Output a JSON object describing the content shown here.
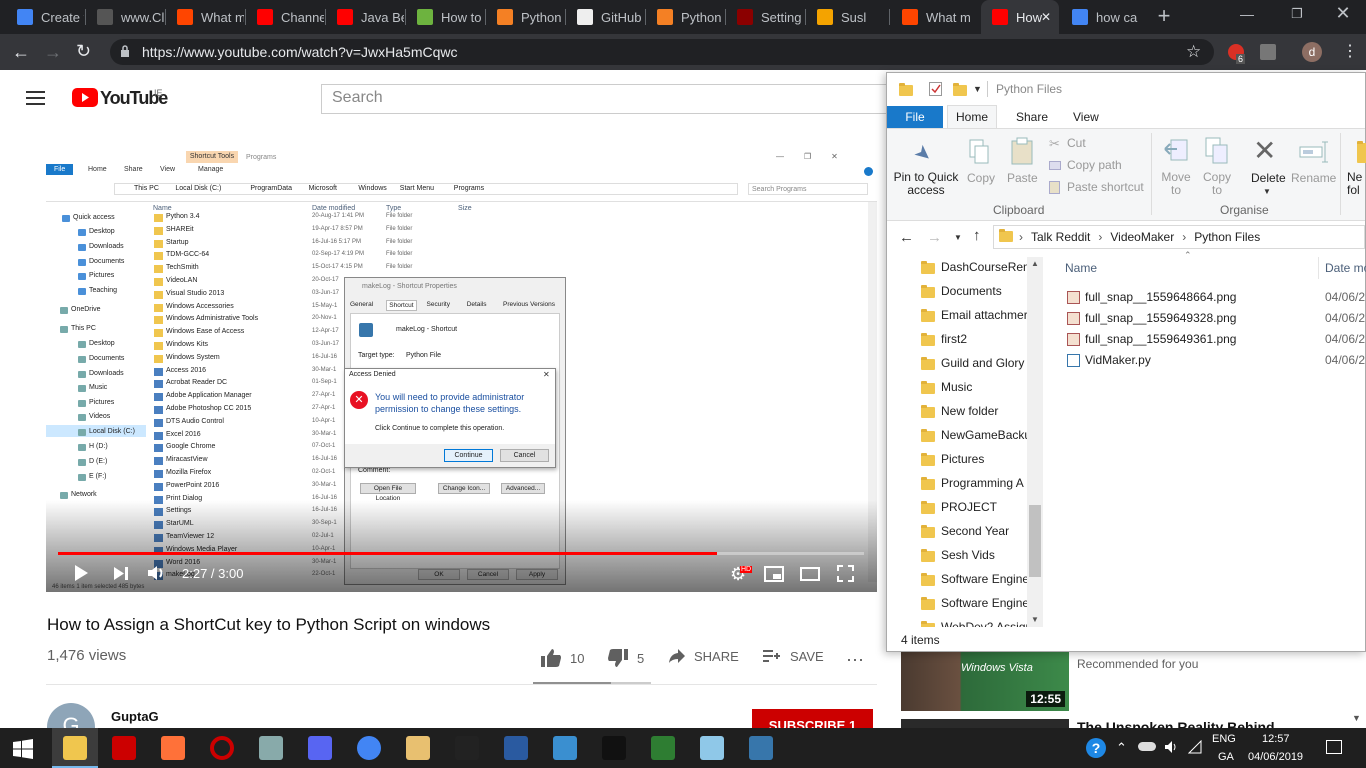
{
  "browser": {
    "tabs": [
      {
        "label": "Create y",
        "color": "#4285f4"
      },
      {
        "label": "www.Cl",
        "color": "#555"
      },
      {
        "label": "What m",
        "color": "#ff4500"
      },
      {
        "label": "Channe",
        "color": "#ff0000"
      },
      {
        "label": "Java Be",
        "color": "#ff0000"
      },
      {
        "label": "How to",
        "color": "#6db33f"
      },
      {
        "label": "Python",
        "color": "#f48024"
      },
      {
        "label": "GitHub",
        "color": "#eee"
      },
      {
        "label": "Python",
        "color": "#f48024"
      },
      {
        "label": "Setting",
        "color": "#8b0000"
      },
      {
        "label": "Susl",
        "color": "#f4a300"
      },
      {
        "label": "What m",
        "color": "#ff4500"
      },
      {
        "label": "How",
        "color": "#ff0000"
      },
      {
        "label": "how ca",
        "color": "#4285f4"
      }
    ],
    "url": "https://www.youtube.com/watch?v=JwxHa5mCqwc",
    "profile_initial": "d",
    "ext_badge": "6"
  },
  "youtube": {
    "logo_text": "YouTube",
    "region": "IE",
    "search_placeholder": "Search",
    "video_title": "How to Assign a ShortCut key to Python Script on windows",
    "views": "1,476 views",
    "likes": "10",
    "dislikes": "5",
    "share": "SHARE",
    "save": "SAVE",
    "time": "2:27 / 3:00",
    "progress": 0.817,
    "hd_badge": "HD",
    "channel_initial": "G",
    "channel_name": "GuptaG",
    "subscribe": "SUBSCRIBE 1",
    "rec1": {
      "label": "Recommended for you",
      "duration": "12:55",
      "thumb_text": "Windows Vista"
    },
    "rec2": {
      "title": "The Unspoken Reality Behind"
    }
  },
  "video_frame": {
    "ribbon_tabs": [
      "File",
      "Home",
      "Share",
      "View",
      "Manage"
    ],
    "shortcut_tools": "Shortcut Tools",
    "programs": "Programs",
    "path": [
      "This PC",
      "Local Disk (C:)",
      "ProgramData",
      "Microsoft",
      "Windows",
      "Start Menu",
      "Programs"
    ],
    "search": "Search Programs",
    "nav": [
      "Quick access",
      "Desktop",
      "Downloads",
      "Documents",
      "Pictures",
      "Teaching",
      "OneDrive",
      "This PC",
      "Desktop",
      "Documents",
      "Downloads",
      "Music",
      "Pictures",
      "Videos",
      "Local Disk (C:)",
      "H (D:)",
      "D (E:)",
      "E (F:)",
      "Network"
    ],
    "cols": [
      "Name",
      "Date modified",
      "Type",
      "Size"
    ],
    "files": [
      {
        "name": "Python 3.4",
        "date": "20-Aug-17 1:41 PM",
        "type": "File folder"
      },
      {
        "name": "SHAREit",
        "date": "19-Apr-17 8:57 PM",
        "type": "File folder"
      },
      {
        "name": "Startup",
        "date": "16-Jul-16 5:17 PM",
        "type": "File folder"
      },
      {
        "name": "TDM-GCC-64",
        "date": "02-Sep-17 4:19 PM",
        "type": "File folder"
      },
      {
        "name": "TechSmith",
        "date": "15-Oct-17 4:15 PM",
        "type": "File folder"
      },
      {
        "name": "VideoLAN",
        "date": "20-Oct-17",
        "type": ""
      },
      {
        "name": "Visual Studio 2013",
        "date": "03-Jun-17",
        "type": ""
      },
      {
        "name": "Windows Accessories",
        "date": "15-May-1",
        "type": ""
      },
      {
        "name": "Windows Administrative Tools",
        "date": "20-Nov-1",
        "type": ""
      },
      {
        "name": "Windows Ease of Access",
        "date": "12-Apr-17",
        "type": ""
      },
      {
        "name": "Windows Kits",
        "date": "03-Jun-17",
        "type": ""
      },
      {
        "name": "Windows System",
        "date": "16-Jul-16",
        "type": ""
      },
      {
        "name": "Access 2016",
        "date": "30-Mar-1",
        "type": ""
      },
      {
        "name": "Acrobat Reader DC",
        "date": "01-Sep-1",
        "type": ""
      },
      {
        "name": "Adobe Application Manager",
        "date": "27-Apr-1",
        "type": ""
      },
      {
        "name": "Adobe Photoshop CC 2015",
        "date": "27-Apr-1",
        "type": ""
      },
      {
        "name": "DTS Audio Control",
        "date": "10-Apr-1",
        "type": ""
      },
      {
        "name": "Excel 2016",
        "date": "30-Mar-1",
        "type": ""
      },
      {
        "name": "Google Chrome",
        "date": "07-Oct-1",
        "type": ""
      },
      {
        "name": "MiracastView",
        "date": "16-Jul-16",
        "type": ""
      },
      {
        "name": "Mozilla Firefox",
        "date": "02-Oct-1",
        "type": ""
      },
      {
        "name": "PowerPoint 2016",
        "date": "30-Mar-1",
        "type": ""
      },
      {
        "name": "Print Dialog",
        "date": "16-Jul-16",
        "type": ""
      },
      {
        "name": "Settings",
        "date": "16-Jul-16",
        "type": ""
      },
      {
        "name": "StarUML",
        "date": "30-Sep-1",
        "type": ""
      },
      {
        "name": "TeamViewer 12",
        "date": "02-Jul-1",
        "type": ""
      },
      {
        "name": "Windows Media Player",
        "date": "10-Apr-1",
        "type": ""
      },
      {
        "name": "Word 2016",
        "date": "30-Mar-1",
        "type": ""
      },
      {
        "name": "makeLog",
        "date": "22-Oct-1",
        "type": ""
      }
    ],
    "status": "46 items    1 item selected  485 bytes",
    "props": {
      "title": "makeLog - Shortcut Properties",
      "tabs": [
        "General",
        "Shortcut",
        "Security",
        "Details",
        "Previous Versions"
      ],
      "name": "makeLog - Shortcut",
      "target_type_label": "Target type:",
      "target_type": "Python File",
      "comment_label": "Comment:",
      "btn_open": "Open File Location",
      "btn_icon": "Change Icon...",
      "btn_adv": "Advanced...",
      "ok": "OK",
      "cancel": "Cancel",
      "apply": "Apply"
    },
    "denied": {
      "title": "Access Denied",
      "msg": "You will need to provide administrator permission to change these settings.",
      "sub": "Click Continue to complete this operation.",
      "continue": "Continue",
      "cancel": "Cancel"
    }
  },
  "explorer": {
    "title": "Python Files",
    "tabs": [
      "File",
      "Home",
      "Share",
      "View"
    ],
    "ribbon": {
      "pin": "Pin to Quick access",
      "copy": "Copy",
      "paste": "Paste",
      "cut": "Cut",
      "copy_path": "Copy path",
      "paste_shortcut": "Paste shortcut",
      "clipboard": "Clipboard",
      "move": "Move to",
      "copy_to": "Copy to",
      "delete": "Delete",
      "rename": "Rename",
      "organise": "Organise",
      "new_folder": "Ne fol"
    },
    "path": [
      "Talk Reddit",
      "VideoMaker",
      "Python Files"
    ],
    "nav": [
      "DashCourseRem",
      "Documents",
      "Email attachmer",
      "first2",
      "Guild and Glory",
      "Music",
      "New folder",
      "NewGameBacku",
      "Pictures",
      "Programming A",
      "PROJECT",
      "Second Year",
      "Sesh Vids",
      "Software Engine",
      "Software Engine",
      "WebDev2 Assign"
    ],
    "col_name": "Name",
    "col_date": "Date mo",
    "files": [
      {
        "name": "full_snap__1559648664.png",
        "date": "04/06/2"
      },
      {
        "name": "full_snap__1559649328.png",
        "date": "04/06/2"
      },
      {
        "name": "full_snap__1559649361.png",
        "date": "04/06/2"
      },
      {
        "name": "VidMaker.py",
        "date": "04/06/2"
      }
    ],
    "count": "4 items"
  },
  "taskbar": {
    "lang": "ENG",
    "lang2": "GA",
    "time": "12:57",
    "date": "04/06/2019",
    "icons": [
      "#f0c64e",
      "#cc0000",
      "#ff7139",
      "#cc0000",
      "#8aa",
      "#5865f2",
      "#4285f4",
      "#e8c070",
      "#222",
      "#2a5aa0",
      "#3a8fd0",
      "#111",
      "#2e7d32",
      "#8fc8e8",
      "#3776ab"
    ]
  }
}
